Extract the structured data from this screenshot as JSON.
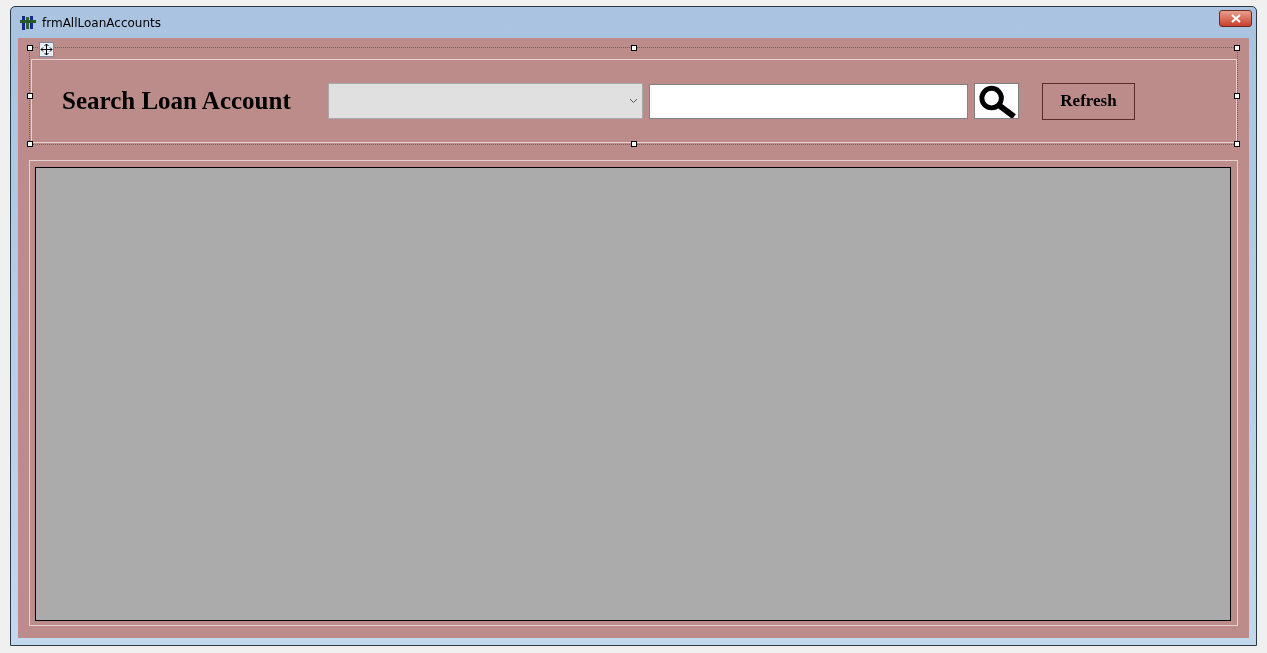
{
  "window": {
    "title": "frmAllLoanAccounts"
  },
  "search_bar": {
    "label": "Search Loan Account",
    "refresh_button": "Refresh"
  }
}
